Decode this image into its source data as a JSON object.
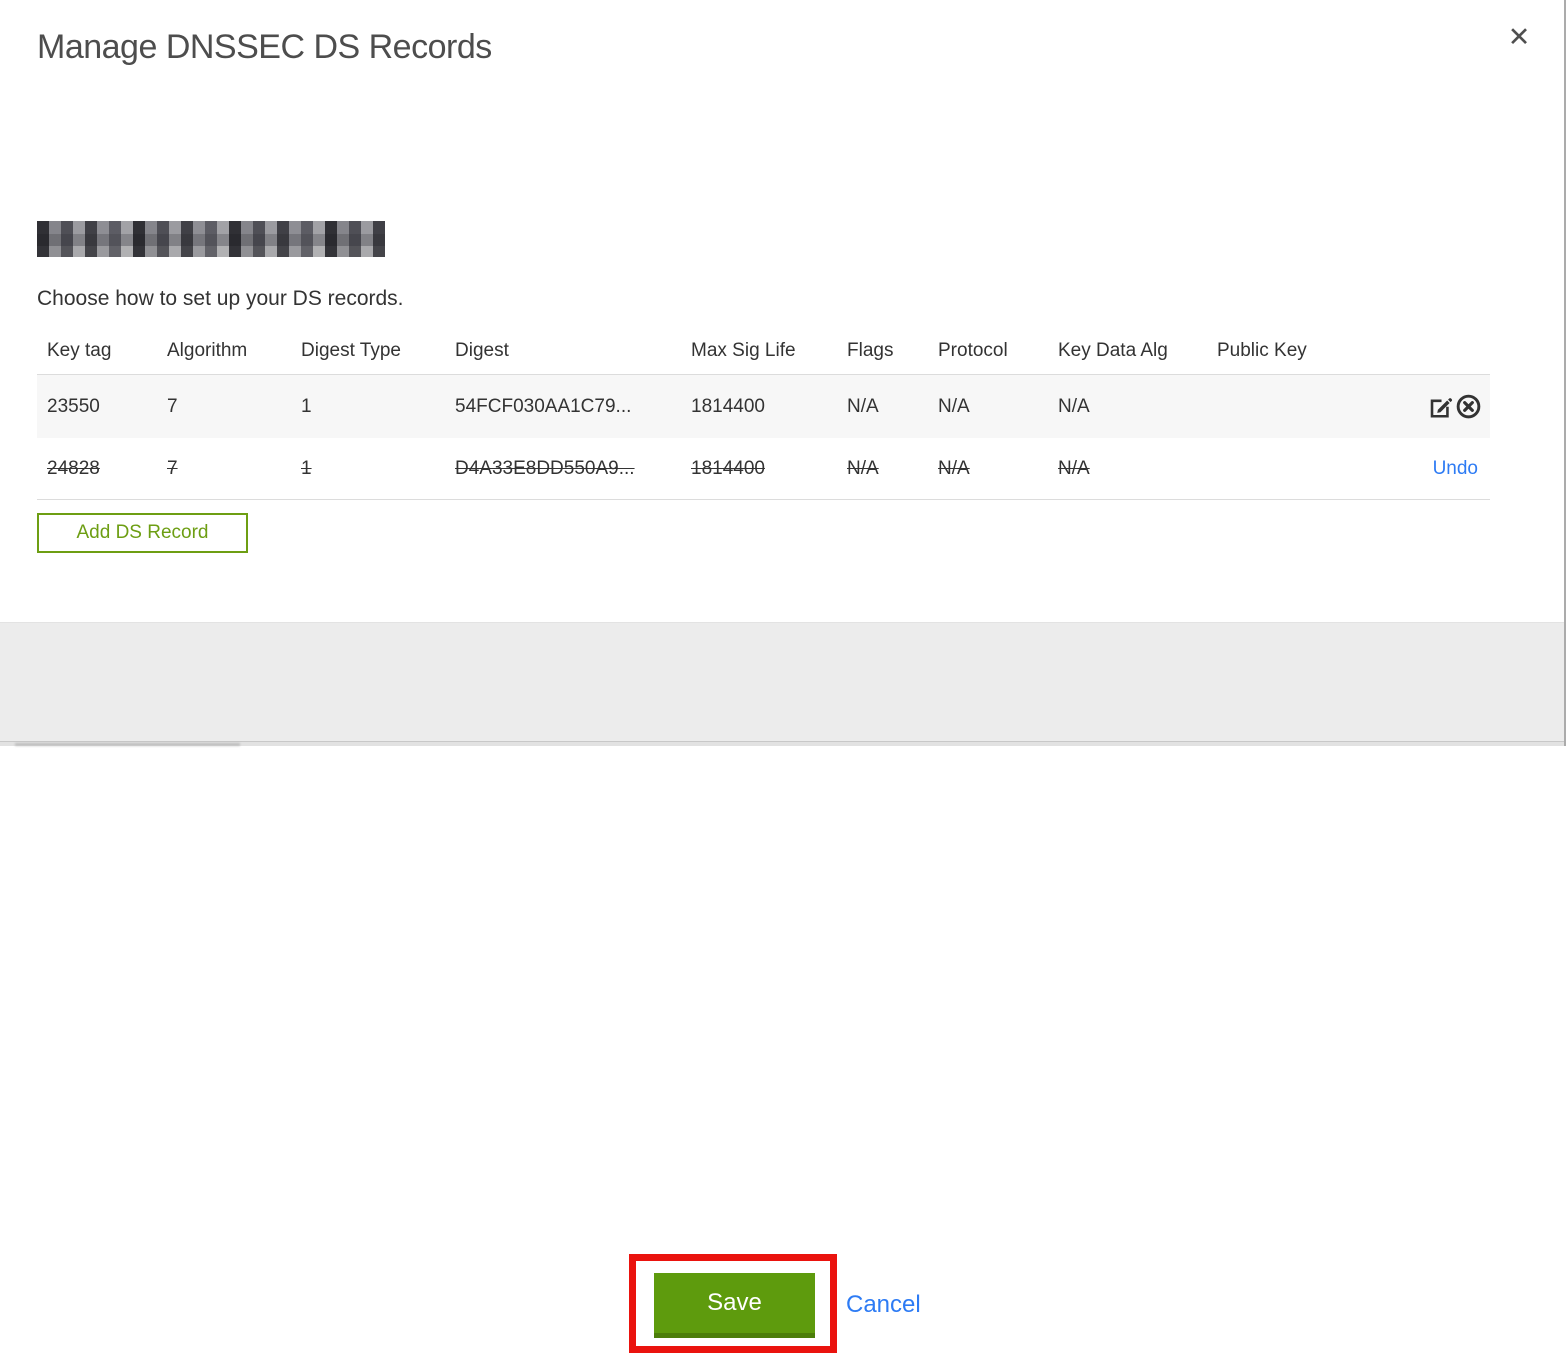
{
  "modal": {
    "title": "Manage DNSSEC DS Records",
    "close_icon": "✕",
    "domain": {
      "redacted": true
    },
    "subtitle": "Choose how to set up your DS records.",
    "table": {
      "columns": [
        "Key tag",
        "Algorithm",
        "Digest Type",
        "Digest",
        "Max Sig Life",
        "Flags",
        "Protocol",
        "Key Data Alg",
        "Public Key"
      ],
      "rows": [
        {
          "key_tag": "23550",
          "algorithm": "7",
          "digest_type": "1",
          "digest": "54FCF030AA1C79...",
          "max_sig_life": "1814400",
          "flags": "N/A",
          "protocol": "N/A",
          "key_data_alg": "N/A",
          "public_key": "",
          "state": "normal",
          "actions": [
            "edit",
            "delete"
          ]
        },
        {
          "key_tag": "24828",
          "algorithm": "7",
          "digest_type": "1",
          "digest": "D4A33E8DD550A9...",
          "max_sig_life": "1814400",
          "flags": "N/A",
          "protocol": "N/A",
          "key_data_alg": "N/A",
          "public_key": "",
          "state": "deleted",
          "undo_label": "Undo"
        }
      ]
    },
    "add_button_label": "Add DS Record",
    "footer": {
      "save_label": "Save",
      "cancel_label": "Cancel"
    }
  },
  "colors": {
    "accent_green": "#5e9b0d",
    "outline_green": "#6d9e13",
    "link_blue": "#2d7bf4",
    "annotation_red": "#ea130e",
    "footer_gray": "#ececec",
    "row_gray": "#f7f7f7",
    "text": "#333333"
  }
}
